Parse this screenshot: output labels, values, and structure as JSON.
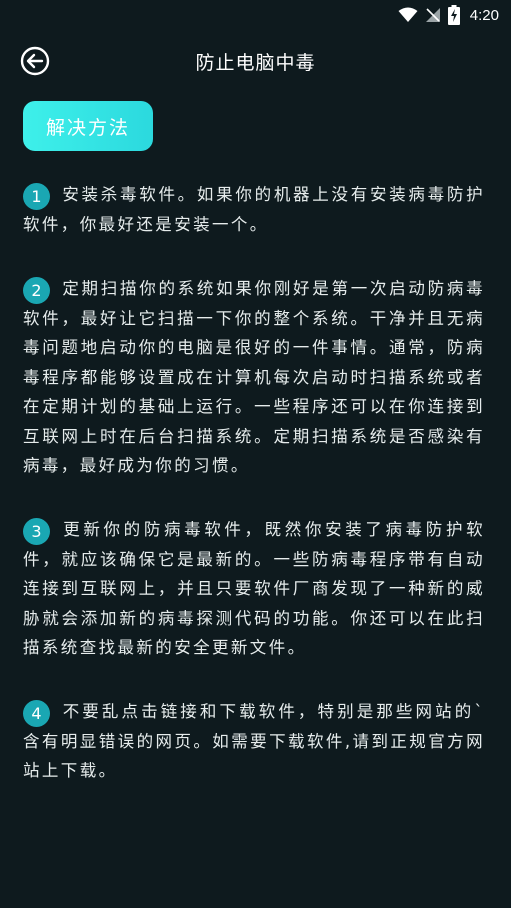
{
  "status_bar": {
    "time": "4:20",
    "icons": [
      "wifi-icon",
      "signal-off-icon",
      "battery-charging-icon"
    ]
  },
  "header": {
    "back_icon": "circle-arrow-left-icon",
    "title": "防止电脑中毒"
  },
  "solution_button": {
    "label": "解决方法"
  },
  "items": [
    {
      "number": "1",
      "text": "安装杀毒软件。如果你的机器上没有安装病毒防护软件，你最好还是安装一个。"
    },
    {
      "number": "2",
      "text": "定期扫描你的系统如果你刚好是第一次启动防病毒软件，最好让它扫描一下你的整个系统。干净并且无病毒问题地启动你的电脑是很好的一件事情。通常，防病毒程序都能够设置成在计算机每次启动时扫描系统或者在定期计划的基础上运行。一些程序还可以在你连接到互联网上时在后台扫描系统。定期扫描系统是否感染有病毒，最好成为你的习惯。"
    },
    {
      "number": "3",
      "text": "更新你的防病毒软件，既然你安装了病毒防护软件，就应该确保它是最新的。一些防病毒程序带有自动连接到互联网上，并且只要软件厂商发现了一种新的威胁就会添加新的病毒探测代码的功能。你还可以在此扫描系统查找最新的安全更新文件。"
    },
    {
      "number": "4",
      "text": "不要乱点击链接和下载软件，特别是那些网站的`含有明显错误的网页。如需要下载软件,请到正规官方网站上下载。"
    }
  ],
  "colors": {
    "background": "#0e1a1e",
    "accent": "#3ef0ea",
    "number_badge": "#1aa7b3"
  }
}
